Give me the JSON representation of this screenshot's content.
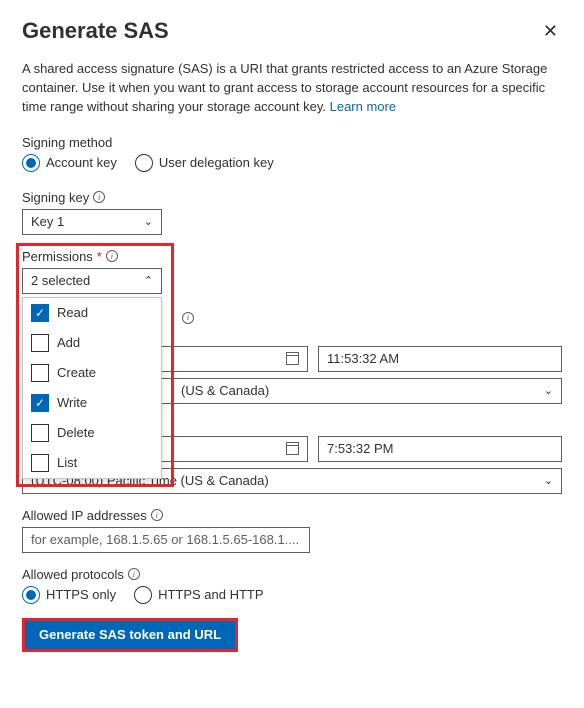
{
  "header": {
    "title": "Generate SAS"
  },
  "description": {
    "text": "A shared access signature (SAS) is a URI that grants restricted access to an Azure Storage container. Use it when you want to grant access to storage account resources for a specific time range without sharing your storage account key.",
    "learn_more": "Learn more"
  },
  "signing_method": {
    "label": "Signing method",
    "options": {
      "account_key": "Account key",
      "user_delegation_key": "User delegation key"
    },
    "selected": "account_key"
  },
  "signing_key": {
    "label": "Signing key",
    "value": "Key 1"
  },
  "permissions": {
    "label": "Permissions",
    "summary": "2 selected",
    "options": [
      {
        "label": "Read",
        "checked": true
      },
      {
        "label": "Add",
        "checked": false
      },
      {
        "label": "Create",
        "checked": false
      },
      {
        "label": "Write",
        "checked": true
      },
      {
        "label": "Delete",
        "checked": false
      },
      {
        "label": "List",
        "checked": false
      }
    ]
  },
  "start_datetime": {
    "time": "11:53:32 AM",
    "tz": "(US & Canada)"
  },
  "expiry_datetime": {
    "time": "7:53:32 PM",
    "tz_full": "(UTC-08:00) Pacific Time (US & Canada)"
  },
  "allowed_ip": {
    "label": "Allowed IP addresses",
    "placeholder": "for example, 168.1.5.65 or 168.1.5.65-168.1...."
  },
  "allowed_protocols": {
    "label": "Allowed protocols",
    "options": {
      "https_only": "HTTPS only",
      "https_and_http": "HTTPS and HTTP"
    },
    "selected": "https_only"
  },
  "generate_button": "Generate SAS token and URL"
}
